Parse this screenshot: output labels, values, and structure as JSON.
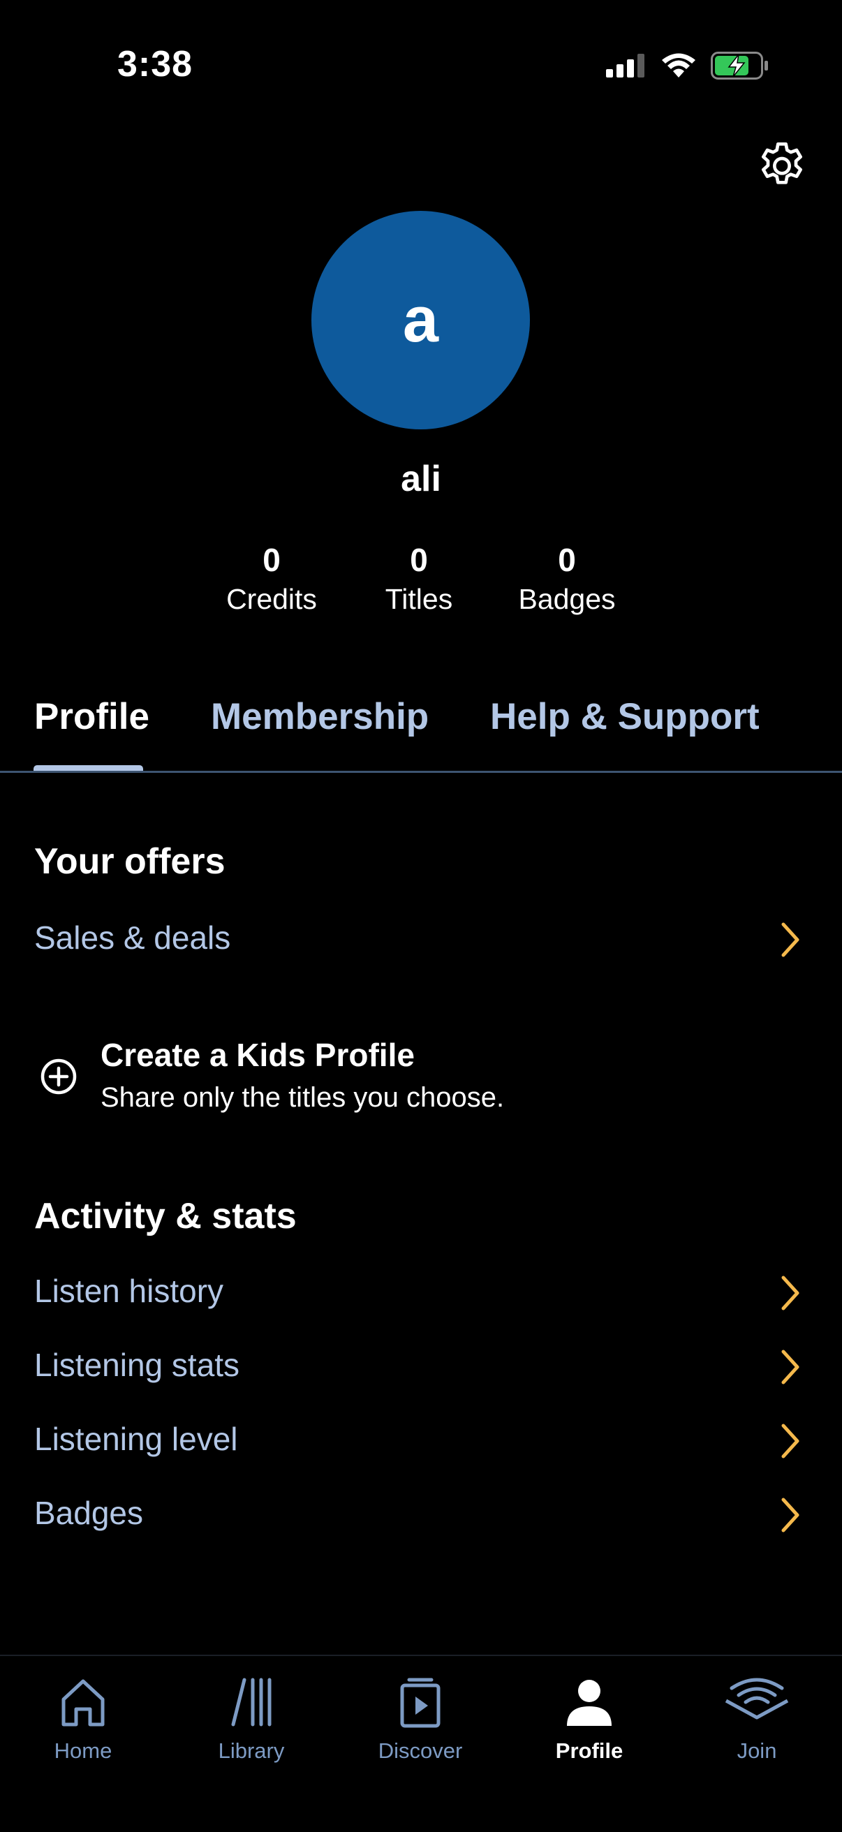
{
  "status_bar": {
    "time": "3:38"
  },
  "profile": {
    "avatar_letter": "a",
    "username": "ali",
    "stats": [
      {
        "value": "0",
        "label": "Credits"
      },
      {
        "value": "0",
        "label": "Titles"
      },
      {
        "value": "0",
        "label": "Badges"
      }
    ]
  },
  "tabs": [
    {
      "label": "Profile",
      "active": true
    },
    {
      "label": "Membership",
      "active": false
    },
    {
      "label": "Help & Support",
      "active": false
    }
  ],
  "offers": {
    "title": "Your offers",
    "items": [
      {
        "label": "Sales & deals"
      }
    ]
  },
  "kids": {
    "title": "Create a Kids Profile",
    "subtitle": "Share only the titles you choose."
  },
  "activity": {
    "title": "Activity & stats",
    "items": [
      {
        "label": "Listen history"
      },
      {
        "label": "Listening stats"
      },
      {
        "label": "Listening level"
      },
      {
        "label": "Badges"
      }
    ]
  },
  "nav": [
    {
      "label": "Home",
      "icon": "home-icon",
      "active": false
    },
    {
      "label": "Library",
      "icon": "library-icon",
      "active": false
    },
    {
      "label": "Discover",
      "icon": "discover-icon",
      "active": false
    },
    {
      "label": "Profile",
      "icon": "profile-icon",
      "active": true
    },
    {
      "label": "Join",
      "icon": "join-icon",
      "active": false
    }
  ],
  "colors": {
    "background": "#000000",
    "avatar": "#0e5a9c",
    "link_text": "#b3c7e6",
    "chevron": "#f5b94c",
    "nav_inactive": "#7d9bc4",
    "battery_charge": "#34c759"
  }
}
